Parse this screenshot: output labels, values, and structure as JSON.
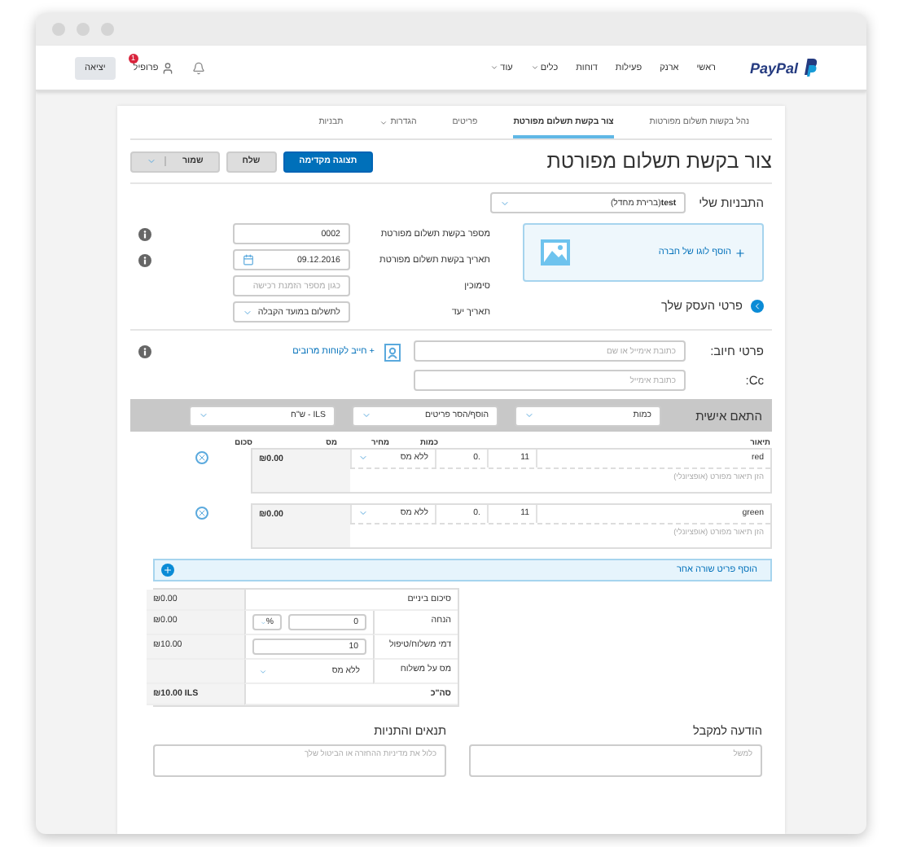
{
  "nav": {
    "logo": "PayPal",
    "links": [
      {
        "label": "ראשי",
        "dropdown": false
      },
      {
        "label": "ארנק",
        "dropdown": false
      },
      {
        "label": "פעילות",
        "dropdown": false
      },
      {
        "label": "דוחות",
        "dropdown": false
      },
      {
        "label": "כלים",
        "dropdown": true
      },
      {
        "label": "עוד",
        "dropdown": true
      }
    ],
    "profile": "פרופיל",
    "badge": "1",
    "logout": "יציאה"
  },
  "tabs": [
    {
      "label": "נהל בקשות תשלום מפורטות",
      "selected": false,
      "dropdown": false
    },
    {
      "label": "צור בקשת תשלום מפורטת",
      "selected": true,
      "dropdown": false
    },
    {
      "label": "פריטים",
      "selected": false,
      "dropdown": false
    },
    {
      "label": "הגדרות",
      "selected": false,
      "dropdown": true
    },
    {
      "label": "תבניות",
      "selected": false,
      "dropdown": false
    }
  ],
  "page_title": "צור בקשת תשלום מפורטת",
  "actions": [
    {
      "label": "תצוגה מקדימה",
      "kind": "primary"
    },
    {
      "label": "שלח",
      "kind": "secondary"
    },
    {
      "label": "שמור",
      "kind": "split"
    }
  ],
  "templates": {
    "label": "התבניות שלי",
    "value": "test",
    "note": "(ברירת מחדל)"
  },
  "logo_box": {
    "label": "הוסף לוגו של חברה"
  },
  "business_details": {
    "label": "פרטי העסק שלך"
  },
  "fields": [
    {
      "label": "מספר בקשת תשלום מפורטת",
      "value": "0002",
      "kind": "text",
      "info": true
    },
    {
      "label": "תאריך בקשת תשלום מפורטת",
      "value": "09.12.2016",
      "kind": "date",
      "info": true
    },
    {
      "label": "סימוכין",
      "placeholder": "כגון מספר הזמנת רכישה",
      "kind": "text",
      "info": false
    },
    {
      "label": "תאריך יעד",
      "value": "לתשלום במועד הקבלה",
      "kind": "select",
      "info": false
    }
  ],
  "billing": {
    "label": "פרטי חיוב:",
    "placeholder": "כתובת אימייל או שם",
    "multi_link": "+ חייב לקוחות מרובים",
    "cc_label": "Cc:",
    "cc_placeholder": "כתובת אימייל"
  },
  "customize": {
    "label": "התאם אישית",
    "selects": [
      "כמות",
      "הוסף/הסר פריטים",
      "ILS - ש\"ח"
    ]
  },
  "columns": [
    "תיאור",
    "כמות",
    "מחיר",
    "מס",
    "סכום"
  ],
  "items": [
    {
      "name": "red",
      "quantity": "11",
      "price": ".0",
      "tax": "ללא מס",
      "amount": "₪0.00",
      "placeholder": "הזן תיאור מפורט (אופציונלי)"
    },
    {
      "name": "green",
      "quantity": "11",
      "price": ".0",
      "tax": "ללא מס",
      "amount": "₪0.00",
      "placeholder": "הזן תיאור מפורט (אופציונלי)"
    }
  ],
  "add_item": "הוסף פריט שורה אחר",
  "totals": [
    {
      "kind": "plain",
      "label": "סיכום ביניים",
      "amount": "₪0.00"
    },
    {
      "kind": "discount",
      "label": "הנחה",
      "value": "0",
      "unit": "%",
      "amount": "₪0.00"
    },
    {
      "kind": "input",
      "label": "דמי משלוח/טיפול",
      "value": "10",
      "amount": "₪10.00"
    },
    {
      "kind": "select",
      "label": "מס על משלוח",
      "value": "ללא מס"
    },
    {
      "kind": "total",
      "label": "סה\"כ",
      "amount": "₪10.00 ILS"
    }
  ],
  "notes": [
    {
      "label": "הודעה למקבל",
      "placeholder": "למשל"
    },
    {
      "label": "תנאים והתניות",
      "placeholder": "כלול את מדיניות ההחזרה או הביטול שלך"
    }
  ]
}
